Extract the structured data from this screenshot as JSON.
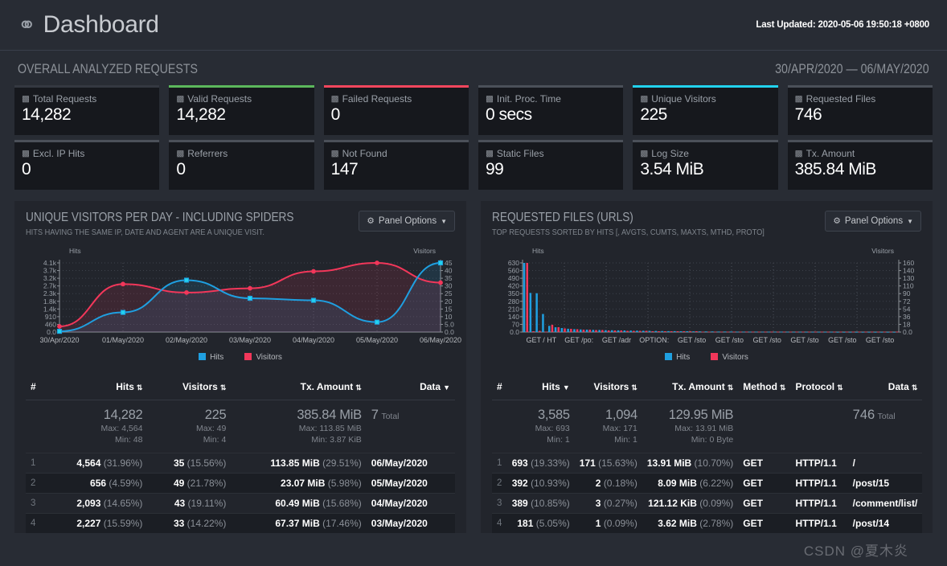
{
  "header": {
    "brand_icon": "speedometer-icon",
    "title": "Dashboard",
    "last_updated": "Last Updated: 2020-05-06 19:50:18 +0800"
  },
  "overview": {
    "section_title": "OVERALL ANALYZED REQUESTS",
    "date_range": "30/APR/2020 — 06/MAY/2020",
    "cards": [
      {
        "label": "Total Requests",
        "value": "14,282",
        "accent": "#343841"
      },
      {
        "label": "Excl. IP Hits",
        "value": "0",
        "accent": "#4b5059"
      },
      {
        "label": "Valid Requests",
        "value": "14,282",
        "accent": "#5cb85c"
      },
      {
        "label": "Referrers",
        "value": "0",
        "accent": "#4b5059"
      },
      {
        "label": "Failed Requests",
        "value": "0",
        "accent": "#f6465d"
      },
      {
        "label": "Not Found",
        "value": "147",
        "accent": "#4b5059"
      },
      {
        "label": "Init. Proc. Time",
        "value": "0 secs",
        "accent": "#4b5059"
      },
      {
        "label": "Static Files",
        "value": "99",
        "accent": "#4b5059"
      },
      {
        "label": "Unique Visitors",
        "value": "225",
        "accent": "#22d3ee"
      },
      {
        "label": "Log Size",
        "value": "3.54 MiB",
        "accent": "#4b5059"
      },
      {
        "label": "Requested Files",
        "value": "746",
        "accent": "#4b5059"
      },
      {
        "label": "Tx. Amount",
        "value": "385.84 MiB",
        "accent": "#4b5059"
      }
    ]
  },
  "panels": [
    {
      "title": "UNIQUE VISITORS PER DAY - INCLUDING SPIDERS",
      "subtitle": "HITS HAVING THE SAME IP, DATE AND AGENT ARE A UNIQUE VISIT.",
      "options_label": "Panel Options",
      "columns": [
        {
          "label": "#",
          "sort": "none"
        },
        {
          "label": "Hits",
          "sort": "both"
        },
        {
          "label": "Visitors",
          "sort": "both"
        },
        {
          "label": "Tx. Amount",
          "sort": "both"
        },
        {
          "label": "Data",
          "sort": "desc"
        }
      ],
      "summary": {
        "hits": "14,282",
        "hits_max": "Max: 4,564",
        "hits_min": "Min: 48",
        "visitors": "225",
        "visitors_max": "Max: 49",
        "visitors_min": "Min: 4",
        "tx": "385.84 MiB",
        "tx_max": "Max: 113.85 MiB",
        "tx_min": "Min: 3.87 KiB",
        "total": "7",
        "total_label": "Total"
      },
      "rows": [
        {
          "idx": "1",
          "hits": "4,564",
          "hits_pct": "(31.96%)",
          "visitors": "35",
          "visitors_pct": "(15.56%)",
          "tx": "113.85 MiB",
          "tx_pct": "(29.51%)",
          "data": "06/May/2020"
        },
        {
          "idx": "2",
          "hits": "656",
          "hits_pct": "(4.59%)",
          "visitors": "49",
          "visitors_pct": "(21.78%)",
          "tx": "23.07 MiB",
          "tx_pct": "(5.98%)",
          "data": "05/May/2020"
        },
        {
          "idx": "3",
          "hits": "2,093",
          "hits_pct": "(14.65%)",
          "visitors": "43",
          "visitors_pct": "(19.11%)",
          "tx": "60.49 MiB",
          "tx_pct": "(15.68%)",
          "data": "04/May/2020"
        },
        {
          "idx": "4",
          "hits": "2,227",
          "hits_pct": "(15.59%)",
          "visitors": "33",
          "visitors_pct": "(14.22%)",
          "tx": "67.37 MiB",
          "tx_pct": "(17.46%)",
          "data": "03/May/2020"
        }
      ]
    },
    {
      "title": "REQUESTED FILES (URLS)",
      "subtitle": "TOP REQUESTS SORTED BY HITS [, AVGTS, CUMTS, MAXTS, MTHD, PROTO]",
      "options_label": "Panel Options",
      "columns": [
        {
          "label": "#",
          "sort": "none"
        },
        {
          "label": "Hits",
          "sort": "desc"
        },
        {
          "label": "Visitors",
          "sort": "both"
        },
        {
          "label": "Tx. Amount",
          "sort": "both"
        },
        {
          "label": "Method",
          "sort": "both"
        },
        {
          "label": "Protocol",
          "sort": "both"
        },
        {
          "label": "Data",
          "sort": "both"
        }
      ],
      "summary": {
        "hits": "3,585",
        "hits_max": "Max: 693",
        "hits_min": "Min: 1",
        "visitors": "1,094",
        "visitors_max": "Max: 171",
        "visitors_min": "Min: 1",
        "tx": "129.95 MiB",
        "tx_max": "Max: 13.91 MiB",
        "tx_min": "Min: 0 Byte",
        "total": "746",
        "total_label": "Total"
      },
      "rows": [
        {
          "idx": "1",
          "hits": "693",
          "hits_pct": "(19.33%)",
          "visitors": "171",
          "visitors_pct": "(15.63%)",
          "tx": "13.91 MiB",
          "tx_pct": "(10.70%)",
          "method": "GET",
          "protocol": "HTTP/1.1",
          "data": "/"
        },
        {
          "idx": "2",
          "hits": "392",
          "hits_pct": "(10.93%)",
          "visitors": "2",
          "visitors_pct": "(0.18%)",
          "tx": "8.09 MiB",
          "tx_pct": "(6.22%)",
          "method": "GET",
          "protocol": "HTTP/1.1",
          "data": "/post/15"
        },
        {
          "idx": "3",
          "hits": "389",
          "hits_pct": "(10.85%)",
          "visitors": "3",
          "visitors_pct": "(0.27%)",
          "tx": "121.12 KiB",
          "tx_pct": "(0.09%)",
          "method": "GET",
          "protocol": "HTTP/1.1",
          "data": "/comment/list/"
        },
        {
          "idx": "4",
          "hits": "181",
          "hits_pct": "(5.05%)",
          "visitors": "1",
          "visitors_pct": "(0.09%)",
          "tx": "3.62 MiB",
          "tx_pct": "(2.78%)",
          "method": "GET",
          "protocol": "HTTP/1.1",
          "data": "/post/14"
        }
      ]
    }
  ],
  "watermark": "CSDN @夏木炎",
  "chart_data": [
    {
      "type": "line",
      "title": "UNIQUE VISITORS PER DAY - INCLUDING SPIDERS",
      "xlabel": "",
      "ylabel": "Hits",
      "y2label": "Visitors",
      "grid": true,
      "legend": [
        "Hits",
        "Visitors"
      ],
      "legend_position": "bottom",
      "colors": {
        "Hits": "#1f9fe0",
        "Visitors": "#f2375a"
      },
      "categories": [
        "30/Apr/2020",
        "01/May/2020",
        "02/May/2020",
        "03/May/2020",
        "04/May/2020",
        "05/May/2020",
        "06/May/2020"
      ],
      "ytick_labels": [
        "0.0",
        "460",
        "910",
        "1.4k",
        "1.8k",
        "2.3k",
        "2.7k",
        "3.2k",
        "3.7k",
        "4.1k"
      ],
      "y2tick_labels": [
        "0.0",
        "5.0",
        "10",
        "15",
        "20",
        "25",
        "30",
        "35",
        "40",
        "45"
      ],
      "ylim": [
        0,
        4564
      ],
      "y2lim": [
        0,
        49
      ],
      "series": [
        {
          "name": "Hits",
          "axis": "left",
          "values": [
            48,
            1297,
            3426,
            2227,
            2093,
            656,
            4564
          ]
        },
        {
          "name": "Visitors",
          "axis": "right",
          "values": [
            4,
            34,
            28,
            31,
            43,
            49,
            35
          ]
        }
      ]
    },
    {
      "type": "bar",
      "title": "REQUESTED FILES (URLS)",
      "xlabel": "",
      "ylabel": "Hits",
      "y2label": "Visitors",
      "grid": true,
      "legend": [
        "Hits",
        "Visitors"
      ],
      "legend_position": "bottom",
      "colors": {
        "Hits": "#1f9fe0",
        "Visitors": "#f2375a"
      },
      "categories": [
        "GET / HT",
        "GET /po:",
        "GET /adr",
        "OPTION:",
        "GET /sto",
        "GET /sto",
        "GET /sto",
        "GET /sto",
        "GET /sto",
        "GET /sto"
      ],
      "ytick_labels": [
        "0.0",
        "70",
        "140",
        "210",
        "280",
        "350",
        "420",
        "490",
        "560",
        "630"
      ],
      "y2tick_labels": [
        "0.0",
        "18",
        "36",
        "54",
        "72",
        "90",
        "110",
        "130",
        "140",
        "160"
      ],
      "ylim": [
        0,
        693
      ],
      "y2lim": [
        0,
        171
      ],
      "series": [
        {
          "name": "Hits",
          "axis": "left",
          "values": [
            693,
            392,
            389,
            181,
            62,
            48,
            40,
            33,
            29,
            26,
            24,
            22,
            21,
            19,
            18,
            17,
            16,
            15,
            14,
            13,
            12,
            11,
            10,
            9,
            9,
            8,
            8,
            7,
            7,
            6,
            6,
            5,
            5,
            5,
            4,
            4,
            4,
            4,
            3,
            3,
            3,
            3,
            3,
            2,
            2,
            2,
            2,
            2,
            2,
            2,
            1,
            1,
            1,
            1,
            1,
            1,
            1,
            1,
            1,
            1
          ]
        },
        {
          "name": "Visitors",
          "axis": "right",
          "values": [
            171,
            2,
            3,
            1,
            18,
            12,
            9,
            8,
            7,
            6,
            6,
            5,
            5,
            4,
            4,
            4,
            3,
            3,
            3,
            3,
            2,
            2,
            2,
            2,
            2,
            2,
            2,
            2,
            1,
            1,
            1,
            1,
            1,
            1,
            1,
            1,
            1,
            1,
            1,
            1,
            1,
            1,
            1,
            1,
            1,
            1,
            1,
            1,
            1,
            1,
            1,
            1,
            1,
            1,
            1,
            1,
            1,
            1,
            1,
            1
          ]
        }
      ]
    }
  ]
}
